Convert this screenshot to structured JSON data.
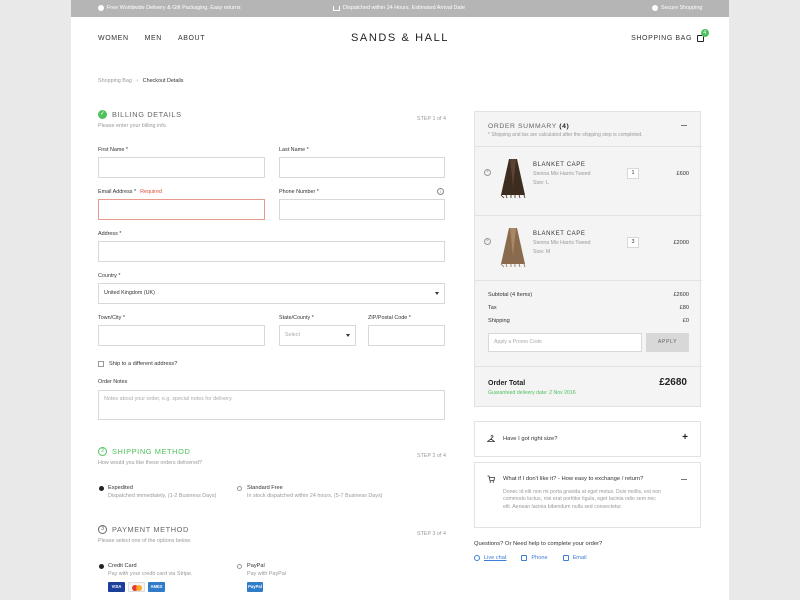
{
  "topbar": {
    "left": "Free Worldwide Delivery & Gift Packaging. Easy returns",
    "center": "Dispatched within 24 Hours. Estimated Arrival Date",
    "right": "Secure Shopping"
  },
  "header": {
    "nav": [
      "WOMEN",
      "MEN",
      "ABOUT"
    ],
    "logo": "SANDS & HALL",
    "bag_label": "SHOPPING BAG",
    "bag_count": "4"
  },
  "breadcrumb": {
    "parent": "Shopping Bag",
    "separator": "›",
    "current": "Checkout Details"
  },
  "billing": {
    "title": "BILLING DETAILS",
    "subtitle": "Please enter your billing info.",
    "step": "STEP 1 of 4",
    "first_name_label": "First Name *",
    "last_name_label": "Last Name *",
    "email_label": "Email Address *",
    "email_error": "Required",
    "phone_label": "Phone Number *",
    "address_label": "Address *",
    "country_label": "Country *",
    "country_value": "United Kingdom (UK)",
    "town_label": "Town/City *",
    "state_label": "State/County *",
    "state_placeholder": "Select",
    "zip_label": "ZIP/Postal Code *",
    "ship_diff_label": "Ship to a different address?",
    "notes_label": "Order Notes",
    "notes_placeholder": "Notes about your order, e.g. special notes for delivery."
  },
  "shipping": {
    "number": "2",
    "title": "SHIPPING METHOD",
    "subtitle": "How would you like these orders delivered?",
    "step": "STEP 2 of 4",
    "options": [
      {
        "title": "Expedited",
        "desc": "Dispatched immediately, (1-2 Business Days)",
        "selected": true
      },
      {
        "title": "Standard Free",
        "desc": "In stock dispatched within 24 hours, (5-7 Business Days)",
        "selected": false
      }
    ]
  },
  "payment": {
    "number": "3",
    "title": "PAYMENT METHOD",
    "subtitle": "Please select one of the options below.",
    "step": "STEP 3 of 4",
    "options": [
      {
        "title": "Credit Card",
        "desc": "Pay with your credit card via Stripe.",
        "selected": true
      },
      {
        "title": "PayPal",
        "desc": "Pay with PayPal",
        "selected": false
      }
    ],
    "cards": [
      "VISA",
      "",
      "AMEX"
    ],
    "paypal_badge": "PayPal"
  },
  "summary": {
    "title": "ORDER SUMMARY",
    "count": "(4)",
    "subtitle": "* Shipping and tax are calculated after the shipping step is completed.",
    "items": [
      {
        "name": "BLANKET CAPE",
        "desc": "Sienna Mix Harris Tweed",
        "size": "Size: L",
        "qty": "1",
        "price": "£600"
      },
      {
        "name": "BLANKET CAPE",
        "desc": "Sienna Mix Harris Tweed",
        "size": "Size: M",
        "qty": "3",
        "price": "£2000"
      }
    ],
    "subtotal_label": "Subtotal (4 Items)",
    "subtotal": "£2600",
    "tax_label": "Tax",
    "tax": "£80",
    "shipping_label": "Shipping",
    "shipping": "£0",
    "promo_placeholder": "Apply a Promo Code",
    "apply_label": "APPLY",
    "total_label": "Order Total",
    "total": "£2680",
    "delivery": "Guaranteed delivery date: 2 Nov 2016"
  },
  "faq": [
    {
      "title": "Have I got right size?",
      "toggle": "+"
    },
    {
      "title": "What if I don't like it? - How easy to exchange / return?",
      "text": "Donec id elit non mi porta gravida at eget metus. Duis mollis, est non commodo luctus, nisi erat porttitor ligula, eget lacinia odio sem nec elit. Aenean lacinia bibendum nulla sed consectetur."
    }
  ],
  "help": {
    "question": "Questions? Or Need help to complete your order?",
    "links": [
      "Live chat",
      "Phone",
      "Email"
    ]
  },
  "colors": {
    "accent_green": "#4ec15d",
    "error": "#e0523a",
    "link": "#3b7dd8"
  }
}
